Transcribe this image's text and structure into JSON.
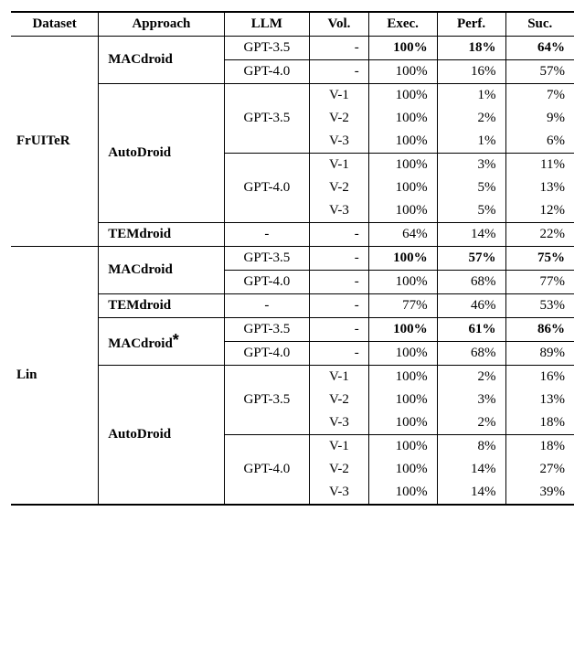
{
  "chart_data": {
    "type": "table",
    "title": "",
    "columns": [
      "Dataset",
      "Approach",
      "LLM",
      "Vol.",
      "Exec.",
      "Perf.",
      "Suc."
    ],
    "data": [
      {
        "dataset": "FrUITeR",
        "approach": "MACdroid",
        "llm": "GPT-3.5",
        "vol": "-",
        "exec": "100%",
        "perf": "18%",
        "suc": "64%",
        "bold": true
      },
      {
        "dataset": "FrUITeR",
        "approach": "MACdroid",
        "llm": "GPT-4.0",
        "vol": "-",
        "exec": "100%",
        "perf": "16%",
        "suc": "57%"
      },
      {
        "dataset": "FrUITeR",
        "approach": "AutoDroid",
        "llm": "GPT-3.5",
        "vol": "V-1",
        "exec": "100%",
        "perf": "1%",
        "suc": "7%"
      },
      {
        "dataset": "FrUITeR",
        "approach": "AutoDroid",
        "llm": "GPT-3.5",
        "vol": "V-2",
        "exec": "100%",
        "perf": "2%",
        "suc": "9%"
      },
      {
        "dataset": "FrUITeR",
        "approach": "AutoDroid",
        "llm": "GPT-3.5",
        "vol": "V-3",
        "exec": "100%",
        "perf": "1%",
        "suc": "6%"
      },
      {
        "dataset": "FrUITeR",
        "approach": "AutoDroid",
        "llm": "GPT-4.0",
        "vol": "V-1",
        "exec": "100%",
        "perf": "3%",
        "suc": "11%"
      },
      {
        "dataset": "FrUITeR",
        "approach": "AutoDroid",
        "llm": "GPT-4.0",
        "vol": "V-2",
        "exec": "100%",
        "perf": "5%",
        "suc": "13%"
      },
      {
        "dataset": "FrUITeR",
        "approach": "AutoDroid",
        "llm": "GPT-4.0",
        "vol": "V-3",
        "exec": "100%",
        "perf": "5%",
        "suc": "12%"
      },
      {
        "dataset": "FrUITeR",
        "approach": "TEMdroid",
        "llm": "-",
        "vol": "-",
        "exec": "64%",
        "perf": "14%",
        "suc": "22%"
      },
      {
        "dataset": "Lin",
        "approach": "MACdroid",
        "llm": "GPT-3.5",
        "vol": "-",
        "exec": "100%",
        "perf": "57%",
        "suc": "75%",
        "bold": true
      },
      {
        "dataset": "Lin",
        "approach": "MACdroid",
        "llm": "GPT-4.0",
        "vol": "-",
        "exec": "100%",
        "perf": "68%",
        "suc": "77%"
      },
      {
        "dataset": "Lin",
        "approach": "TEMdroid",
        "llm": "-",
        "vol": "-",
        "exec": "77%",
        "perf": "46%",
        "suc": "53%"
      },
      {
        "dataset": "Lin",
        "approach": "MACdroid*",
        "llm": "GPT-3.5",
        "vol": "-",
        "exec": "100%",
        "perf": "61%",
        "suc": "86%",
        "bold": true
      },
      {
        "dataset": "Lin",
        "approach": "MACdroid*",
        "llm": "GPT-4.0",
        "vol": "-",
        "exec": "100%",
        "perf": "68%",
        "suc": "89%"
      },
      {
        "dataset": "Lin",
        "approach": "AutoDroid",
        "llm": "GPT-3.5",
        "vol": "V-1",
        "exec": "100%",
        "perf": "2%",
        "suc": "16%"
      },
      {
        "dataset": "Lin",
        "approach": "AutoDroid",
        "llm": "GPT-3.5",
        "vol": "V-2",
        "exec": "100%",
        "perf": "3%",
        "suc": "13%"
      },
      {
        "dataset": "Lin",
        "approach": "AutoDroid",
        "llm": "GPT-3.5",
        "vol": "V-3",
        "exec": "100%",
        "perf": "2%",
        "suc": "18%"
      },
      {
        "dataset": "Lin",
        "approach": "AutoDroid",
        "llm": "GPT-4.0",
        "vol": "V-1",
        "exec": "100%",
        "perf": "8%",
        "suc": "18%"
      },
      {
        "dataset": "Lin",
        "approach": "AutoDroid",
        "llm": "GPT-4.0",
        "vol": "V-2",
        "exec": "100%",
        "perf": "14%",
        "suc": "27%"
      },
      {
        "dataset": "Lin",
        "approach": "AutoDroid",
        "llm": "GPT-4.0",
        "vol": "V-3",
        "exec": "100%",
        "perf": "14%",
        "suc": "39%"
      }
    ]
  },
  "headers": {
    "dataset": "Dataset",
    "approach": "Approach",
    "llm": "LLM",
    "vol": "Vol.",
    "exec": "Exec.",
    "perf": "Perf.",
    "suc": "Suc."
  },
  "labels": {
    "fruiter": "FrUITeR",
    "lin": "Lin",
    "macdroid": "MACdroid",
    "autodroid": "AutoDroid",
    "temdroid": "TEMdroid",
    "macdroid_star_base": "MACdroid",
    "star": "*",
    "gpt35": "GPT-3.5",
    "gpt40": "GPT-4.0",
    "dash": "-",
    "v1": "V-1",
    "v2": "V-2",
    "v3": "V-3"
  },
  "rows": {
    "r1": {
      "exec": "100%",
      "perf": "18%",
      "suc": "64%"
    },
    "r2": {
      "exec": "100%",
      "perf": "16%",
      "suc": "57%"
    },
    "r3": {
      "exec": "100%",
      "perf": "1%",
      "suc": "7%"
    },
    "r4": {
      "exec": "100%",
      "perf": "2%",
      "suc": "9%"
    },
    "r5": {
      "exec": "100%",
      "perf": "1%",
      "suc": "6%"
    },
    "r6": {
      "exec": "100%",
      "perf": "3%",
      "suc": "11%"
    },
    "r7": {
      "exec": "100%",
      "perf": "5%",
      "suc": "13%"
    },
    "r8": {
      "exec": "100%",
      "perf": "5%",
      "suc": "12%"
    },
    "r9": {
      "exec": "64%",
      "perf": "14%",
      "suc": "22%"
    },
    "r10": {
      "exec": "100%",
      "perf": "57%",
      "suc": "75%"
    },
    "r11": {
      "exec": "100%",
      "perf": "68%",
      "suc": "77%"
    },
    "r12": {
      "exec": "77%",
      "perf": "46%",
      "suc": "53%"
    },
    "r13": {
      "exec": "100%",
      "perf": "61%",
      "suc": "86%"
    },
    "r14": {
      "exec": "100%",
      "perf": "68%",
      "suc": "89%"
    },
    "r15": {
      "exec": "100%",
      "perf": "2%",
      "suc": "16%"
    },
    "r16": {
      "exec": "100%",
      "perf": "3%",
      "suc": "13%"
    },
    "r17": {
      "exec": "100%",
      "perf": "2%",
      "suc": "18%"
    },
    "r18": {
      "exec": "100%",
      "perf": "8%",
      "suc": "18%"
    },
    "r19": {
      "exec": "100%",
      "perf": "14%",
      "suc": "27%"
    },
    "r20": {
      "exec": "100%",
      "perf": "14%",
      "suc": "39%"
    }
  }
}
